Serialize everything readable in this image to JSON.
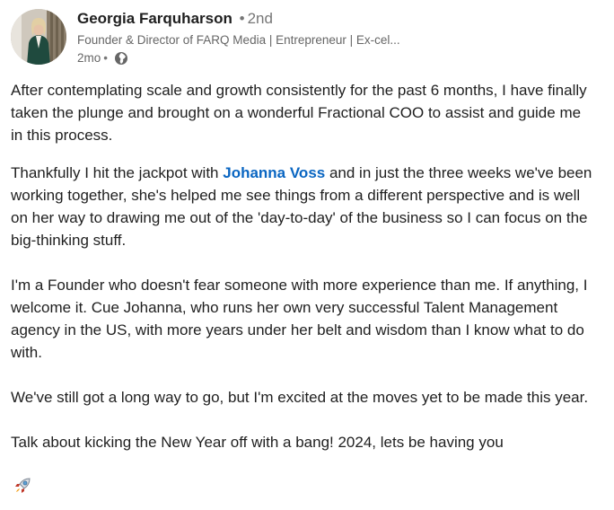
{
  "author": {
    "name": "Georgia Farquharson",
    "degree": "2nd",
    "separator": "•",
    "headline": "Founder & Director of FARQ Media | Entrepreneur | Ex-cel...",
    "time": "2mo",
    "visibility_icon": "globe-icon"
  },
  "post": {
    "p1": "After contemplating scale and growth consistently for the past 6 months, I have finally taken the plunge and brought on a wonderful Fractional COO to assist and guide me in this process.",
    "p2_before": "Thankfully I hit the jackpot with ",
    "mention": "Johanna Voss",
    "p2_after": " and in just the three weeks we've been working together, she's helped me see things from a different perspective and is well on her way to drawing me out of the 'day-to-day' of the business so I can focus on the big-thinking stuff.",
    "p3": "I'm a Founder who doesn't fear someone with more experience than me. If anything, I welcome it. Cue Johanna, who runs her own very successful Talent Management agency in the US, with more years under her belt and wisdom than I know what to do with.",
    "p4": "We've still got a long way to go, but I'm excited at the moves yet to be made this year.",
    "p5": "Talk about kicking the New Year off with a bang! 2024, lets be having you",
    "emoji_icon": "rocket-icon"
  },
  "colors": {
    "mention": "#0a66c2",
    "text": "#1f1f1f",
    "muted": "#666666"
  }
}
